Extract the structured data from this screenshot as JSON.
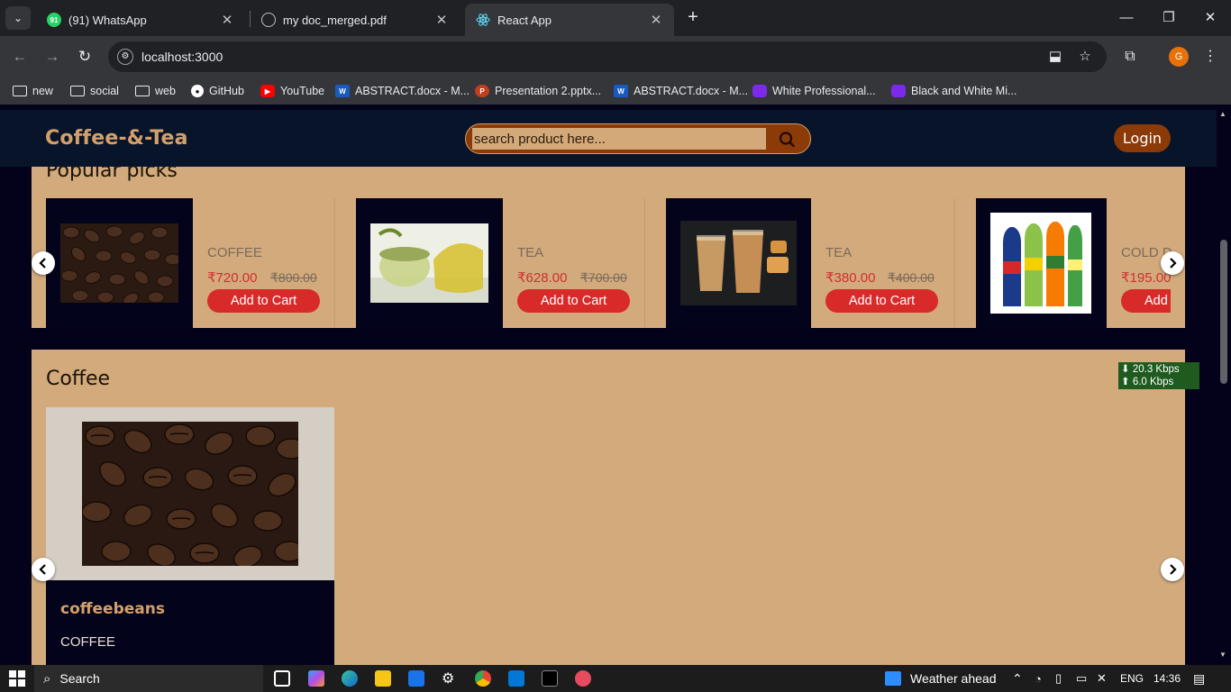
{
  "browser": {
    "tabs": [
      {
        "title": "(91) WhatsApp",
        "color": "#25d366",
        "fav_text": "91"
      },
      {
        "title": "my doc_merged.pdf",
        "color": "#5f6368",
        "fav_text": ""
      },
      {
        "title": "React App",
        "color": "#61dafb",
        "fav_text": ""
      }
    ],
    "url": "localhost:3000",
    "profile_letter": "G",
    "bookmarks": [
      {
        "label": "new",
        "type": "folder"
      },
      {
        "label": "social",
        "type": "folder"
      },
      {
        "label": "web",
        "type": "folder"
      },
      {
        "label": "GitHub",
        "type": "github"
      },
      {
        "label": "YouTube",
        "type": "youtube"
      },
      {
        "label": "ABSTRACT.docx - M...",
        "type": "word"
      },
      {
        "label": "Presentation 2.pptx...",
        "type": "ppt"
      },
      {
        "label": "ABSTRACT.docx - M...",
        "type": "word"
      },
      {
        "label": "White Professional...",
        "type": "canva"
      },
      {
        "label": "Black and White Mi...",
        "type": "canva"
      }
    ]
  },
  "site": {
    "logo": "Coffee-&-Tea",
    "search_placeholder": "search product here...",
    "login_label": "Login"
  },
  "popular": {
    "title": "Popular picks",
    "items": [
      {
        "category": "COFFEE",
        "price": "₹720.00",
        "old_price": "₹800.00",
        "button": "Add to Cart",
        "image": "coffee-beans"
      },
      {
        "category": "TEA",
        "price": "₹628.00",
        "old_price": "₹700.00",
        "button": "Add to Cart",
        "image": "green-tea"
      },
      {
        "category": "TEA",
        "price": "₹380.00",
        "old_price": "₹400.00",
        "button": "Add to Cart",
        "image": "milk-tea"
      },
      {
        "category": "COLD D",
        "price": "₹195.00",
        "old_price": "",
        "button": "Add",
        "image": "cold-drinks"
      }
    ]
  },
  "coffee_section": {
    "title": "Coffee",
    "card": {
      "name": "coffeebeans",
      "category": "COFFEE",
      "image": "coffee-beans"
    }
  },
  "netspeed": {
    "down": "⬇ 20.3 Kbps",
    "up": "⬆ 6.0 Kbps"
  },
  "taskbar": {
    "search_label": "Search",
    "weather": "Weather ahead",
    "language": "ENG",
    "time": "14:36"
  }
}
